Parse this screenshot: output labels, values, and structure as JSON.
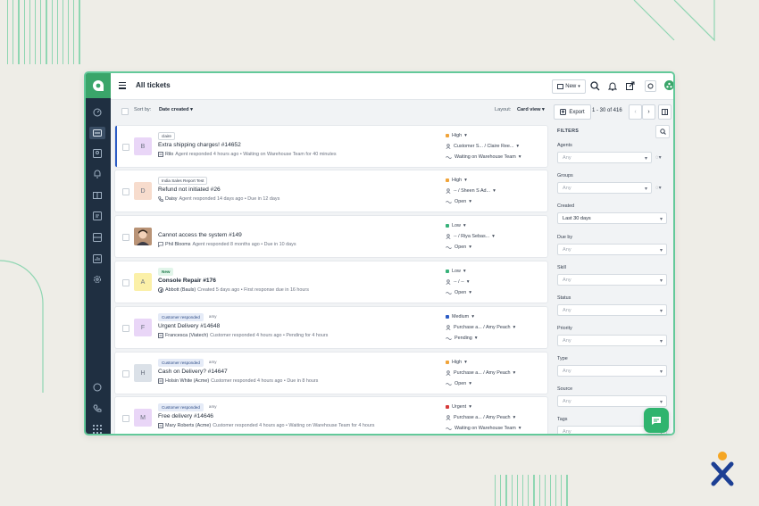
{
  "app": {
    "title": "All tickets",
    "new_label": "New",
    "brand_color": "#3aa56a",
    "accent_color": "#2c5cc5"
  },
  "sortbar": {
    "sort_label": "Sort by:",
    "sort_value": "Date created",
    "layout_label": "Layout:",
    "layout_value": "Card view",
    "export_label": "Export",
    "pagination": "1 - 30 of 416"
  },
  "tickets": [
    {
      "avatar": "B",
      "avatar_color": "#e9d6f7",
      "tags": [
        {
          "text": "claire",
          "kind": "plain-border"
        }
      ],
      "subject": "Extra shipping charges! #14652",
      "meta_icon": "ticket-icon",
      "requester": "Rilo",
      "meta": "Agent responded 4 hours ago • Waiting on Warehouse Team for 40 minutes",
      "priority": "High",
      "priority_color": "#f0a43a",
      "assignee": "Customer S... / Claire Ree...",
      "status": "Waiting on Warehouse Team"
    },
    {
      "avatar": "D",
      "avatar_color": "#f7dccd",
      "tags": [
        {
          "text": "India Sales Report Test",
          "kind": "plain-border"
        }
      ],
      "subject": "Refund not initiated #26",
      "meta_icon": "phone-icon",
      "requester": "Daisy",
      "meta": "Agent responded 14 days ago • Due in 12 days",
      "priority": "High",
      "priority_color": "#f0a43a",
      "assignee": "-- / Sheen S Ad...",
      "status": "Open"
    },
    {
      "avatar": "",
      "avatar_color": "#c7a58a",
      "tags": [],
      "subject": "Cannot access the system #149",
      "meta_icon": "chat-icon",
      "requester": "Phil Blooms",
      "meta": "Agent responded 8 months ago • Due in 10 days",
      "priority": "Low",
      "priority_color": "#38b27a",
      "assignee": "-- / Riya Sebas...",
      "status": "Open"
    },
    {
      "avatar": "A",
      "avatar_color": "#fbf0a8",
      "tags": [
        {
          "text": "New",
          "kind": "new"
        }
      ],
      "subject": "Console Repair #176",
      "meta_icon": "facebook-icon",
      "requester": "Abbott (Bauls)",
      "meta": "Created 5 days ago • First response due in 16 hours",
      "priority": "Low",
      "priority_color": "#38b27a",
      "assignee": "-- / --",
      "status": "Open"
    },
    {
      "avatar": "F",
      "avatar_color": "#e9d6f7",
      "tags": [
        {
          "text": "Customer responded",
          "kind": "cr"
        },
        {
          "text": "amy",
          "kind": "plain"
        }
      ],
      "subject": "Urgent Delivery #14648",
      "meta_icon": "ticket-icon",
      "requester": "Francesca (Viatech)",
      "meta": "Customer responded 4 hours ago • Pending for 4 hours",
      "priority": "Medium",
      "priority_color": "#2c5cc5",
      "assignee": "Purchase a... / Amy Peach",
      "status": "Pending"
    },
    {
      "avatar": "H",
      "avatar_color": "#dbe1e8",
      "tags": [
        {
          "text": "Customer responded",
          "kind": "cr"
        },
        {
          "text": "amy",
          "kind": "plain"
        }
      ],
      "subject": "Cash on Delivery? #14647",
      "meta_icon": "ticket-icon",
      "requester": "Holsin White (Acme)",
      "meta": "Customer responded 4 hours ago • Due in 8 hours",
      "priority": "High",
      "priority_color": "#f0a43a",
      "assignee": "Purchase a... / Amy Peach",
      "status": "Open"
    },
    {
      "avatar": "M",
      "avatar_color": "#e9d6f7",
      "tags": [
        {
          "text": "Customer responded",
          "kind": "cr"
        },
        {
          "text": "amy",
          "kind": "plain"
        }
      ],
      "subject": "Free delivery #14646",
      "meta_icon": "ticket-icon",
      "requester": "Mary Roberts (Acme)",
      "meta": "Customer responded 4 hours ago • Waiting on Warehouse Team for 4 hours",
      "priority": "Urgent",
      "priority_color": "#d63a3a",
      "assignee": "Purchase a... / Amy Peach",
      "status": "Waiting on Warehouse Team"
    }
  ],
  "filters": {
    "heading": "FILTERS",
    "fields": [
      {
        "label": "Agents",
        "value": "Any",
        "placeholder": true
      },
      {
        "label": "Groups",
        "value": "Any",
        "placeholder": true
      },
      {
        "label": "Created",
        "value": "Last 30 days",
        "placeholder": false
      },
      {
        "label": "Due by",
        "value": "Any",
        "placeholder": true
      },
      {
        "label": "Skill",
        "value": "Any",
        "placeholder": true
      },
      {
        "label": "Status",
        "value": "Any",
        "placeholder": true
      },
      {
        "label": "Priority",
        "value": "Any",
        "placeholder": true
      },
      {
        "label": "Type",
        "value": "Any",
        "placeholder": true
      },
      {
        "label": "Source",
        "value": "Any",
        "placeholder": true
      },
      {
        "label": "Tags",
        "value": "Any",
        "placeholder": true
      }
    ]
  }
}
